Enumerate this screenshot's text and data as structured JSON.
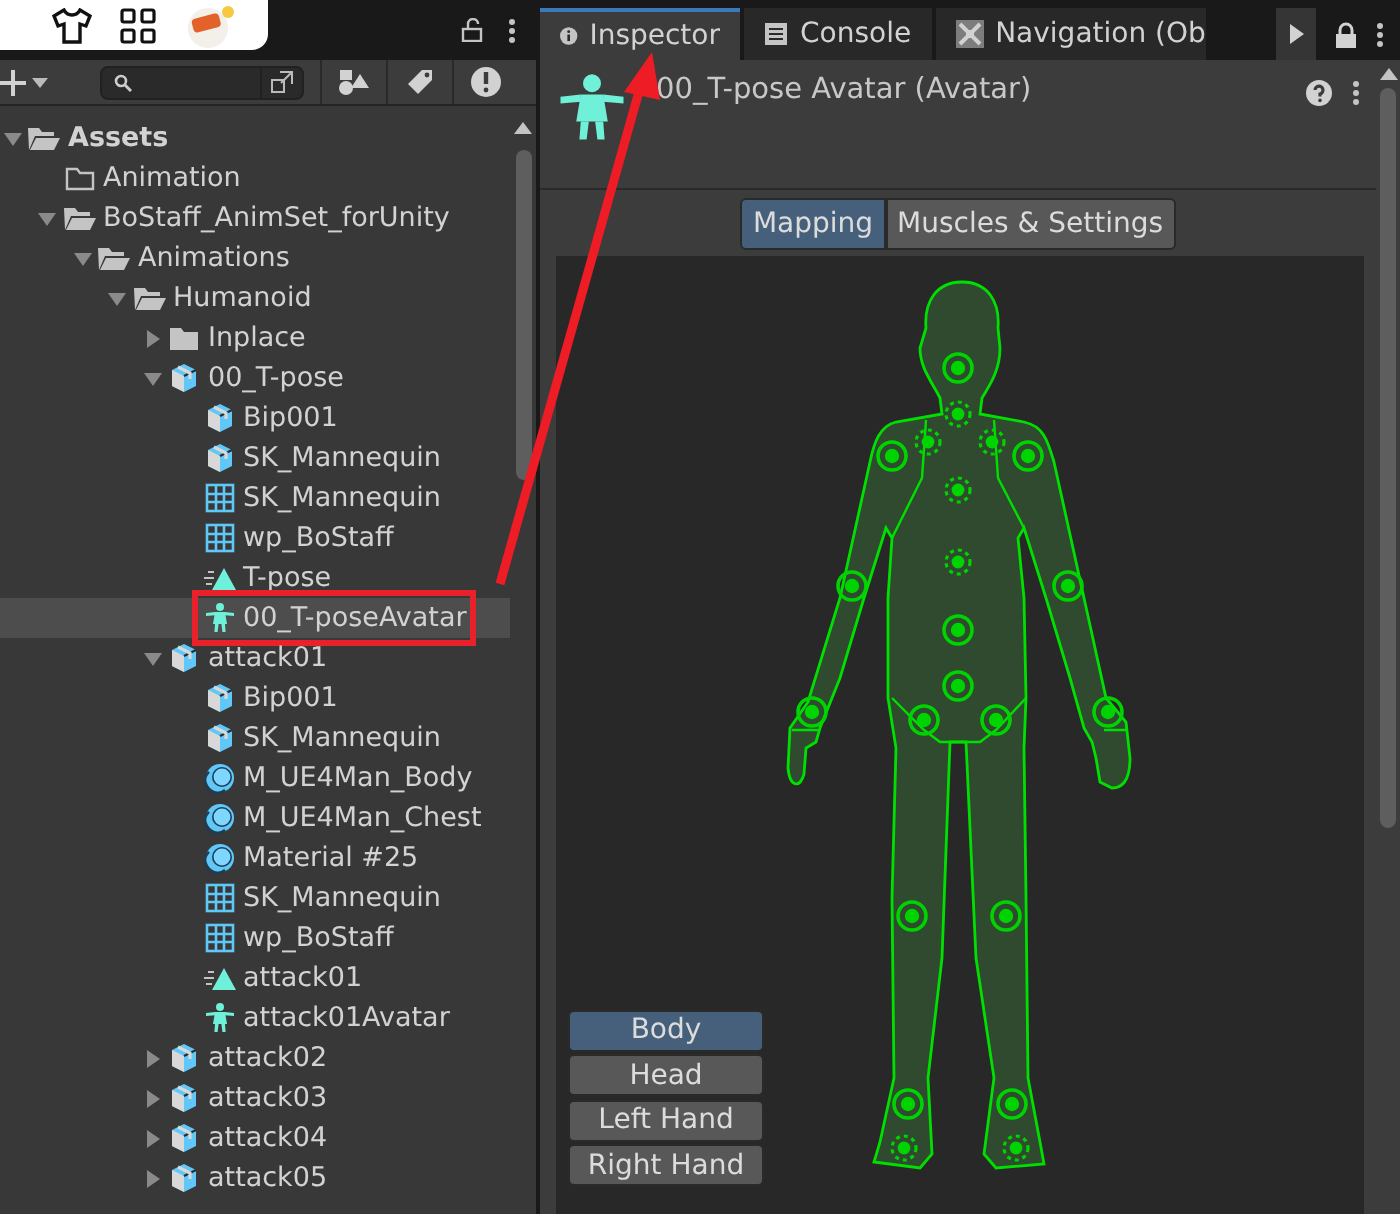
{
  "project": {
    "tree": [
      {
        "label": "Assets",
        "kind": "folder",
        "expanded": true,
        "selected": false,
        "highlighted": false,
        "children": [
          {
            "label": "Animation",
            "kind": "empty-folder",
            "selected": false,
            "highlighted": false
          },
          {
            "label": "BoStaff_AnimSet_forUnity",
            "kind": "folder",
            "expanded": true,
            "selected": false,
            "highlighted": false,
            "children": [
              {
                "label": "Animations",
                "kind": "folder",
                "expanded": true,
                "selected": false,
                "highlighted": false,
                "children": [
                  {
                    "label": "Humanoid",
                    "kind": "folder",
                    "expanded": true,
                    "selected": false,
                    "highlighted": false,
                    "children": [
                      {
                        "label": "Inplace",
                        "kind": "folder",
                        "expanded": false,
                        "selected": false,
                        "highlighted": false
                      },
                      {
                        "label": "00_T-pose",
                        "kind": "model",
                        "expanded": true,
                        "selected": false,
                        "highlighted": false,
                        "children": [
                          {
                            "label": "Bip001",
                            "kind": "model",
                            "selected": false,
                            "highlighted": false
                          },
                          {
                            "label": "SK_Mannequin",
                            "kind": "model",
                            "selected": false,
                            "highlighted": false
                          },
                          {
                            "label": "SK_Mannequin",
                            "kind": "mesh",
                            "selected": false,
                            "highlighted": false
                          },
                          {
                            "label": "wp_BoStaff",
                            "kind": "mesh",
                            "selected": false,
                            "highlighted": false
                          },
                          {
                            "label": "T-pose",
                            "kind": "animation",
                            "selected": false,
                            "highlighted": false
                          },
                          {
                            "label": "00_T-poseAvatar",
                            "kind": "avatar",
                            "selected": true,
                            "highlighted": true
                          }
                        ]
                      },
                      {
                        "label": "attack01",
                        "kind": "model",
                        "expanded": true,
                        "selected": false,
                        "highlighted": false,
                        "children": [
                          {
                            "label": "Bip001",
                            "kind": "model",
                            "selected": false,
                            "highlighted": false
                          },
                          {
                            "label": "SK_Mannequin",
                            "kind": "model",
                            "selected": false,
                            "highlighted": false
                          },
                          {
                            "label": "M_UE4Man_Body",
                            "kind": "material",
                            "selected": false,
                            "highlighted": false
                          },
                          {
                            "label": "M_UE4Man_Chest",
                            "kind": "material",
                            "selected": false,
                            "highlighted": false
                          },
                          {
                            "label": "Material #25",
                            "kind": "material",
                            "selected": false,
                            "highlighted": false
                          },
                          {
                            "label": "SK_Mannequin",
                            "kind": "mesh",
                            "selected": false,
                            "highlighted": false
                          },
                          {
                            "label": "wp_BoStaff",
                            "kind": "mesh",
                            "selected": false,
                            "highlighted": false
                          },
                          {
                            "label": "attack01",
                            "kind": "animation",
                            "selected": false,
                            "highlighted": false
                          },
                          {
                            "label": "attack01Avatar",
                            "kind": "avatar",
                            "selected": false,
                            "highlighted": false
                          }
                        ]
                      },
                      {
                        "label": "attack02",
                        "kind": "model",
                        "expanded": false,
                        "selected": false,
                        "highlighted": false
                      },
                      {
                        "label": "attack03",
                        "kind": "model",
                        "expanded": false,
                        "selected": false,
                        "highlighted": false
                      },
                      {
                        "label": "attack04",
                        "kind": "model",
                        "expanded": false,
                        "selected": false,
                        "highlighted": false
                      },
                      {
                        "label": "attack05",
                        "kind": "model",
                        "expanded": false,
                        "selected": false,
                        "highlighted": false
                      }
                    ]
                  }
                ]
              }
            ]
          }
        ]
      }
    ]
  },
  "inspector": {
    "tabs": [
      {
        "label": "Inspector",
        "kind": "info",
        "selected": true
      },
      {
        "label": "Console",
        "kind": "console",
        "selected": false
      },
      {
        "label": "Navigation (Ob",
        "kind": "navigation",
        "selected": false
      }
    ],
    "title": "00_T-pose Avatar (Avatar)",
    "modes": [
      {
        "label": "Mapping",
        "selected": true
      },
      {
        "label": "Muscles & Settings",
        "selected": false
      }
    ],
    "body_parts": [
      {
        "label": "Body",
        "selected": true
      },
      {
        "label": "Head",
        "selected": false
      },
      {
        "label": "Left Hand",
        "selected": false
      },
      {
        "label": "Right Hand",
        "selected": false
      }
    ]
  }
}
